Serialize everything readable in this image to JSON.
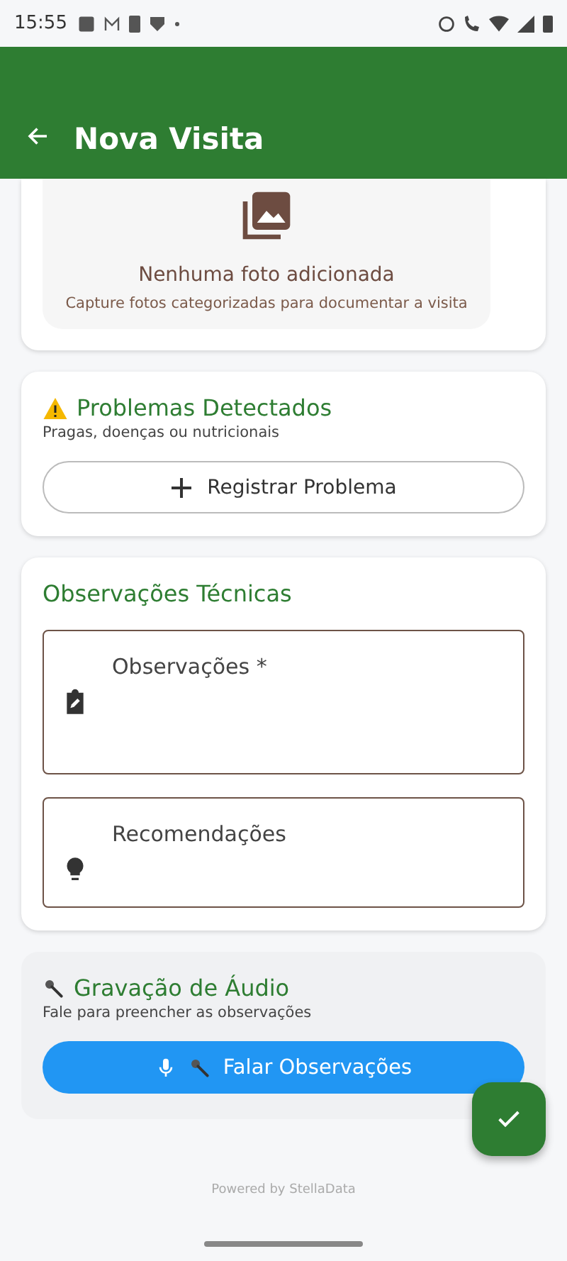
{
  "status_bar": {
    "time": "15:55"
  },
  "app_bar": {
    "title": "Nova Visita"
  },
  "photos": {
    "empty_title": "Nenhuma foto adicionada",
    "empty_hint": "Capture fotos categorizadas para documentar a visita"
  },
  "problems": {
    "title": "Problemas Detectados",
    "subtitle": "Pragas, doenças ou nutricionais",
    "button": "Registrar Problema"
  },
  "observations": {
    "title": "Observações Técnicas",
    "fields": [
      {
        "kind": "notes",
        "placeholder": "Observações *"
      },
      {
        "kind": "idea",
        "placeholder": "Recomendações"
      }
    ]
  },
  "audio": {
    "title": "Gravação de Áudio",
    "subtitle": "Fale para preencher as observações",
    "button": "Falar Observações"
  },
  "footer": "Powered by StellaData"
}
